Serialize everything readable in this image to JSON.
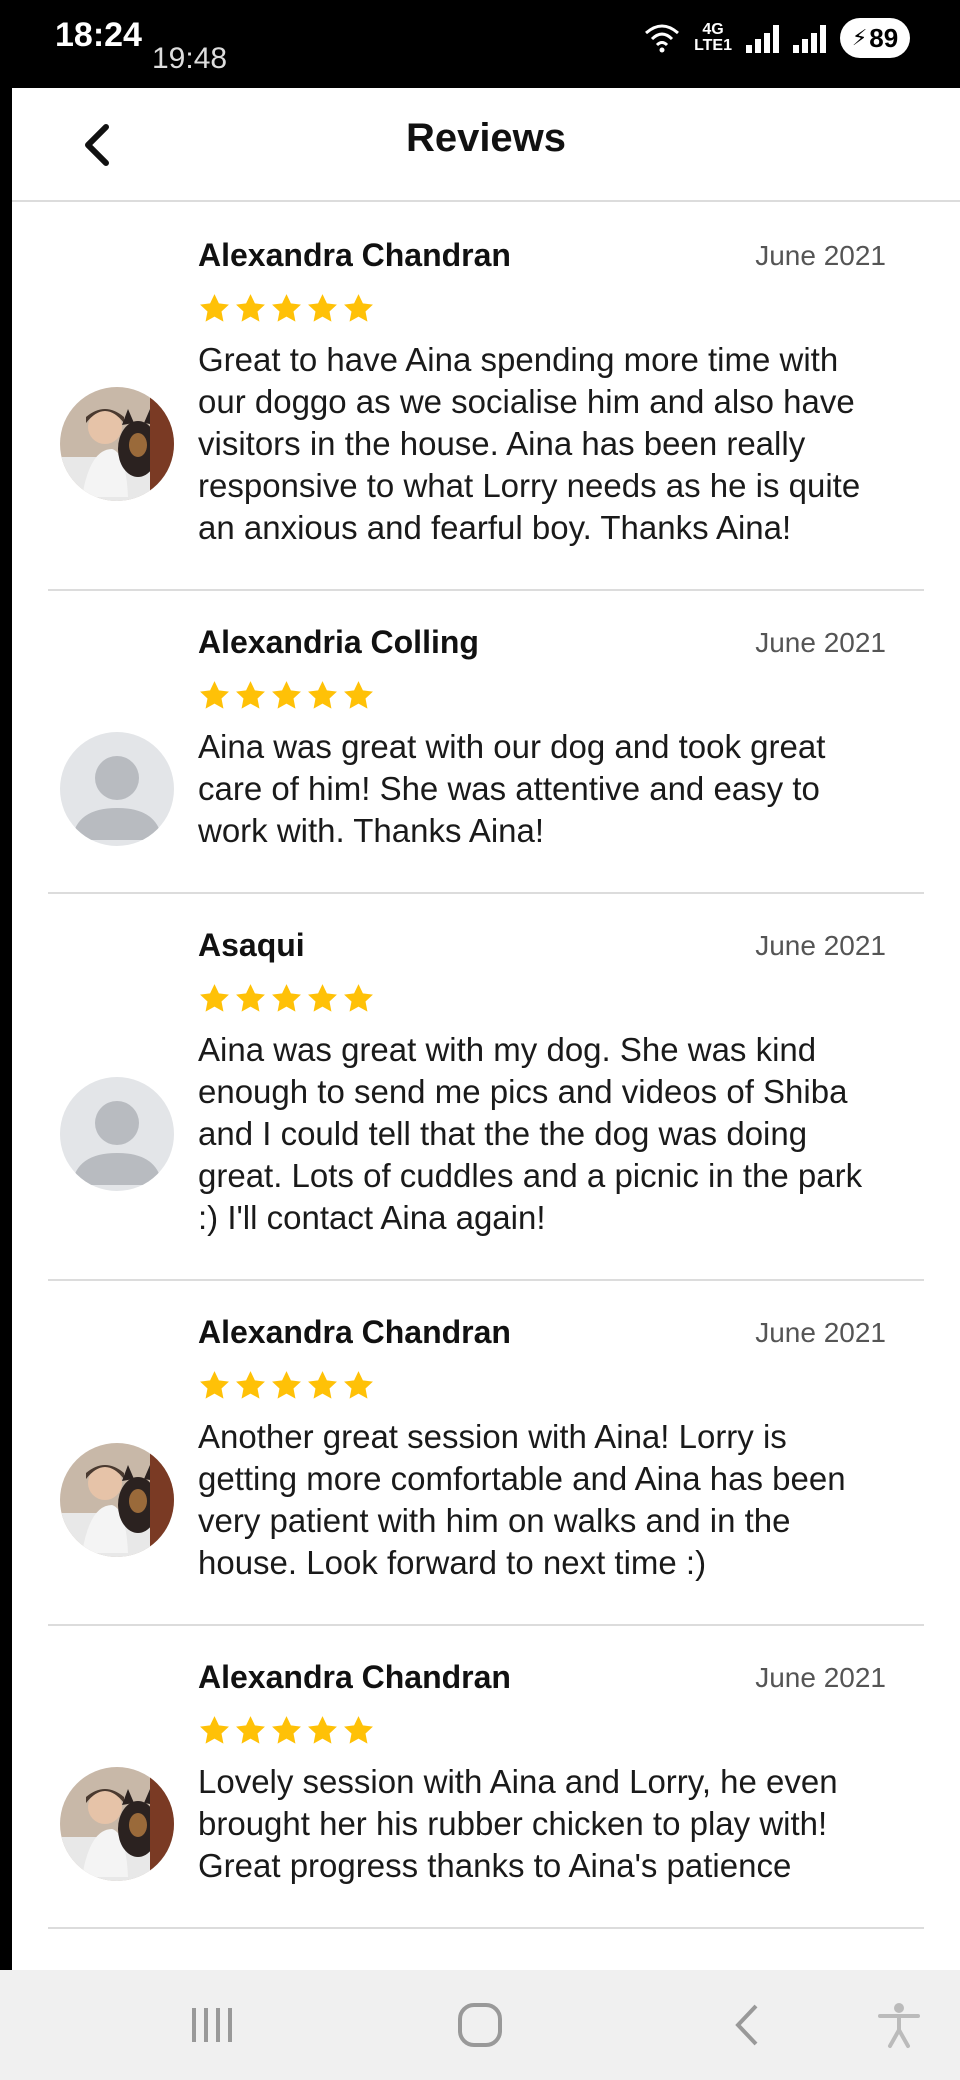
{
  "status_bar": {
    "time": "18:24",
    "secondary_time": "19:48",
    "network": "LTE1",
    "network_type": "4G",
    "battery": "89"
  },
  "header": {
    "title": "Reviews",
    "back_icon": "chevron-left-icon"
  },
  "colors": {
    "star": "#FFC107",
    "divider": "#DCDCDC",
    "placeholder_avatar_bg": "#E3E5E8",
    "placeholder_avatar_fg": "#B8BBC0"
  },
  "reviews": [
    {
      "name": "Alexandra Chandran",
      "date": "June 2021",
      "rating": 5,
      "avatar": "photo",
      "text": "Great to have Aina spending more time with our doggo as we socialise him and also have visitors in the house. Aina has been really responsive to what Lorry needs as he is quite an anxious and fearful boy. Thanks Aina!"
    },
    {
      "name": "Alexandria Colling",
      "date": "June 2021",
      "rating": 5,
      "avatar": "placeholder",
      "text": "Aina was great with our dog and took great care of him! She was attentive and easy to work with. Thanks Aina!"
    },
    {
      "name": "Asaqui",
      "date": "June 2021",
      "rating": 5,
      "avatar": "placeholder",
      "text": "Aina was great with my dog. She was kind enough to send me pics and videos of Shiba and I could tell that the the dog was doing great. Lots of cuddles and a picnic in the park :) I'll contact Aina again!"
    },
    {
      "name": "Alexandra Chandran",
      "date": "June 2021",
      "rating": 5,
      "avatar": "photo",
      "text": "Another great session with Aina! Lorry is getting more comfortable and Aina has been very patient with him on walks and in the house. Look forward to next time :)"
    },
    {
      "name": "Alexandra Chandran",
      "date": "June 2021",
      "rating": 5,
      "avatar": "photo",
      "text": "Lovely session with Aina and Lorry, he even brought her his rubber chicken to play with! Great progress thanks to Aina's patience"
    }
  ],
  "nav_bar": {
    "recents": "recents-icon",
    "home": "home-icon",
    "back": "back-icon",
    "accessibility": "accessibility-icon"
  }
}
